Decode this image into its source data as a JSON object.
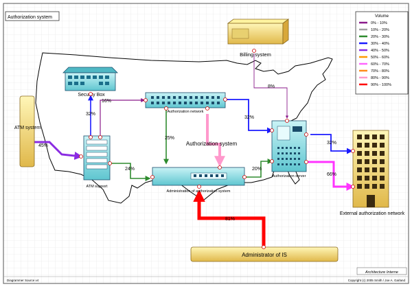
{
  "header": {
    "title": "Authorization system"
  },
  "footer": {
    "left": "Diagrammer Source v4",
    "right": "Copyright (c) 2005 Smith / Joe A. Garland",
    "brand": "Architecture Interne"
  },
  "nodes": {
    "atm_system": "ATM system",
    "security_box": "Security Box",
    "atm_support": "ATM support",
    "authorization_network": "Authorization network",
    "authorization_system": "Authorization system",
    "administration": "Administration of authorization system",
    "billing_system": "Billing system",
    "authorization_server": "Authorization server",
    "external_network": "External authorization network",
    "administrator_is": "Administrator of IS"
  },
  "links": {
    "atm_to_support": "45%",
    "support_to_security": "32%",
    "support_to_network": "16%",
    "network_to_admin": "25%",
    "support_to_admin": "24%",
    "admin_to_server": "20%",
    "network_to_server": "32%",
    "billing_to_server": "8%",
    "server_to_external_top": "32%",
    "server_to_external": "66%",
    "admin_is": "81%"
  },
  "legend": {
    "title": "Volume",
    "items": [
      {
        "label": "0% - 10%",
        "color": "#8a1a8a"
      },
      {
        "label": "10% - 20%",
        "color": "#a0a0a0"
      },
      {
        "label": "20% - 30%",
        "color": "#2e8b2e"
      },
      {
        "label": "30% - 40%",
        "color": "#1a1aff"
      },
      {
        "label": "40% - 50%",
        "color": "#8a2be2"
      },
      {
        "label": "50% - 60%",
        "color": "#ff9900"
      },
      {
        "label": "60% - 70%",
        "color": "#ff66ff"
      },
      {
        "label": "70% - 80%",
        "color": "#ff8c1a"
      },
      {
        "label": "80% - 90%",
        "color": "#ff99cc"
      },
      {
        "label": "90% - 100%",
        "color": "#ff0000"
      }
    ]
  }
}
